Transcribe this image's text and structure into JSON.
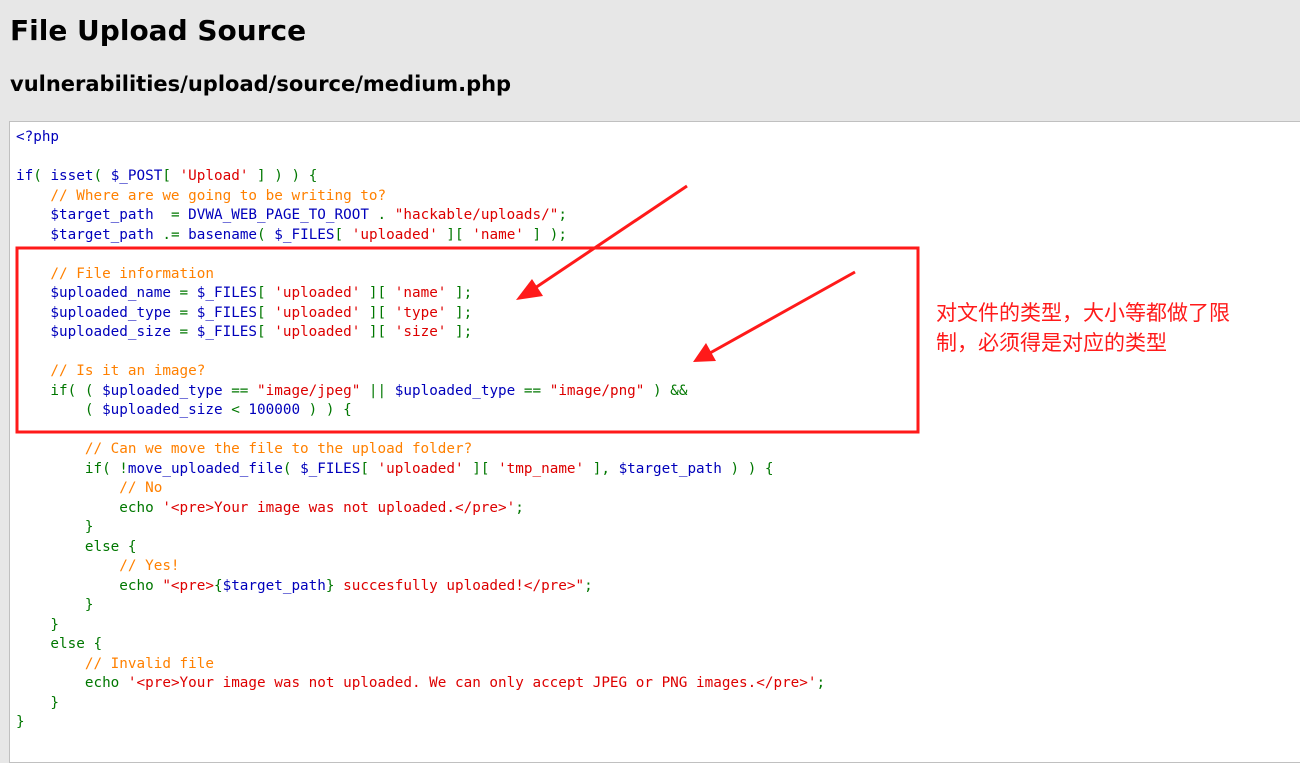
{
  "header": {
    "title": "File Upload Source",
    "subtitle": "vulnerabilities/upload/source/medium.php"
  },
  "annotation": {
    "text": "对文件的类型，大小等都做了限制，必须得是对应的类型",
    "color": "#ff1a1a"
  },
  "colors": {
    "default": "#0000bb",
    "keyword": "#007700",
    "string": "#dd0000",
    "comment": "#ff8000",
    "highlight_box": "#ff1a1a"
  },
  "code_lines": [
    [
      [
        "d",
        "<?php"
      ]
    ],
    [],
    [
      [
        "d",
        "if"
      ],
      [
        "k",
        "( "
      ],
      [
        "d",
        "isset"
      ],
      [
        "k",
        "( "
      ],
      [
        "d",
        "$_POST"
      ],
      [
        "k",
        "[ "
      ],
      [
        "s",
        "'Upload'"
      ],
      [
        "k",
        " ] ) ) {"
      ]
    ],
    [
      [
        "c",
        "    // Where are we going to be writing to?"
      ]
    ],
    [
      [
        "d",
        "    $target_path"
      ],
      [
        "k",
        "  = "
      ],
      [
        "d",
        "DVWA_WEB_PAGE_TO_ROOT"
      ],
      [
        "k",
        " . "
      ],
      [
        "s",
        "\"hackable/uploads/\""
      ],
      [
        "k",
        ";"
      ]
    ],
    [
      [
        "d",
        "    $target_path"
      ],
      [
        "k",
        " .= "
      ],
      [
        "d",
        "basename"
      ],
      [
        "k",
        "( "
      ],
      [
        "d",
        "$_FILES"
      ],
      [
        "k",
        "[ "
      ],
      [
        "s",
        "'uploaded'"
      ],
      [
        "k",
        " ][ "
      ],
      [
        "s",
        "'name'"
      ],
      [
        "k",
        " ] );"
      ]
    ],
    [],
    [
      [
        "c",
        "    // File information"
      ]
    ],
    [
      [
        "d",
        "    $uploaded_name"
      ],
      [
        "k",
        " = "
      ],
      [
        "d",
        "$_FILES"
      ],
      [
        "k",
        "[ "
      ],
      [
        "s",
        "'uploaded'"
      ],
      [
        "k",
        " ][ "
      ],
      [
        "s",
        "'name'"
      ],
      [
        "k",
        " ];"
      ]
    ],
    [
      [
        "d",
        "    $uploaded_type"
      ],
      [
        "k",
        " = "
      ],
      [
        "d",
        "$_FILES"
      ],
      [
        "k",
        "[ "
      ],
      [
        "s",
        "'uploaded'"
      ],
      [
        "k",
        " ][ "
      ],
      [
        "s",
        "'type'"
      ],
      [
        "k",
        " ];"
      ]
    ],
    [
      [
        "d",
        "    $uploaded_size"
      ],
      [
        "k",
        " = "
      ],
      [
        "d",
        "$_FILES"
      ],
      [
        "k",
        "[ "
      ],
      [
        "s",
        "'uploaded'"
      ],
      [
        "k",
        " ][ "
      ],
      [
        "s",
        "'size'"
      ],
      [
        "k",
        " ];"
      ]
    ],
    [],
    [
      [
        "c",
        "    // Is it an image?"
      ]
    ],
    [
      [
        "k",
        "    if( ( "
      ],
      [
        "d",
        "$uploaded_type"
      ],
      [
        "k",
        " == "
      ],
      [
        "s",
        "\"image/jpeg\""
      ],
      [
        "k",
        " || "
      ],
      [
        "d",
        "$uploaded_type"
      ],
      [
        "k",
        " == "
      ],
      [
        "s",
        "\"image/png\""
      ],
      [
        "k",
        " ) &&"
      ]
    ],
    [
      [
        "k",
        "        ( "
      ],
      [
        "d",
        "$uploaded_size"
      ],
      [
        "k",
        " < "
      ],
      [
        "d",
        "100000"
      ],
      [
        "k",
        " ) ) {"
      ]
    ],
    [],
    [
      [
        "c",
        "        // Can we move the file to the upload folder?"
      ]
    ],
    [
      [
        "k",
        "        if( !"
      ],
      [
        "d",
        "move_uploaded_file"
      ],
      [
        "k",
        "( "
      ],
      [
        "d",
        "$_FILES"
      ],
      [
        "k",
        "[ "
      ],
      [
        "s",
        "'uploaded'"
      ],
      [
        "k",
        " ][ "
      ],
      [
        "s",
        "'tmp_name'"
      ],
      [
        "k",
        " ], "
      ],
      [
        "d",
        "$target_path"
      ],
      [
        "k",
        " ) ) {"
      ]
    ],
    [
      [
        "c",
        "            // No"
      ]
    ],
    [
      [
        "k",
        "            echo "
      ],
      [
        "s",
        "'<pre>Your image was not uploaded.</pre>'"
      ],
      [
        "k",
        ";"
      ]
    ],
    [
      [
        "k",
        "        }"
      ]
    ],
    [
      [
        "k",
        "        else {"
      ]
    ],
    [
      [
        "c",
        "            // Yes!"
      ]
    ],
    [
      [
        "k",
        "            echo "
      ],
      [
        "s",
        "\"<pre>"
      ],
      [
        "k",
        "{"
      ],
      [
        "d",
        "$target_path"
      ],
      [
        "k",
        "}"
      ],
      [
        "s",
        " succesfully uploaded!</pre>\""
      ],
      [
        "k",
        ";"
      ]
    ],
    [
      [
        "k",
        "        }"
      ]
    ],
    [
      [
        "k",
        "    }"
      ]
    ],
    [
      [
        "k",
        "    else {"
      ]
    ],
    [
      [
        "c",
        "        // Invalid file"
      ]
    ],
    [
      [
        "k",
        "        echo "
      ],
      [
        "s",
        "'<pre>Your image was not uploaded. We can only accept JPEG or PNG images.</pre>'"
      ],
      [
        "k",
        ";"
      ]
    ],
    [
      [
        "k",
        "    }"
      ]
    ],
    [
      [
        "k",
        "}"
      ]
    ]
  ]
}
